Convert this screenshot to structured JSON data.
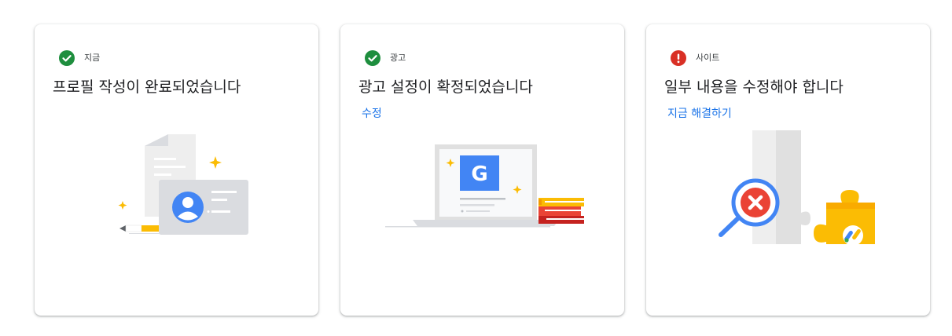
{
  "cards": [
    {
      "status": {
        "icon": "check-circle-icon",
        "color": "#1e8e3e",
        "label": "지금"
      },
      "title": "프로필 작성이 완료되었습니다",
      "link": "",
      "illustration": "profile-document-illustration"
    },
    {
      "status": {
        "icon": "check-circle-icon",
        "color": "#1e8e3e",
        "label": "광고"
      },
      "title": "광고 설정이 확정되었습니다",
      "link": "수정",
      "illustration": "laptop-google-ads-illustration"
    },
    {
      "status": {
        "icon": "error-circle-icon",
        "color": "#d93025",
        "label": "사이트"
      },
      "title": "일부 내용을 수정해야 합니다",
      "link": "지금 해결하기",
      "illustration": "site-error-puzzle-illustration"
    }
  ],
  "colors": {
    "link": "#1a73e8",
    "success": "#1e8e3e",
    "error": "#d93025",
    "google_blue": "#4285f4",
    "google_yellow": "#fbbc04",
    "google_red": "#ea4335"
  }
}
